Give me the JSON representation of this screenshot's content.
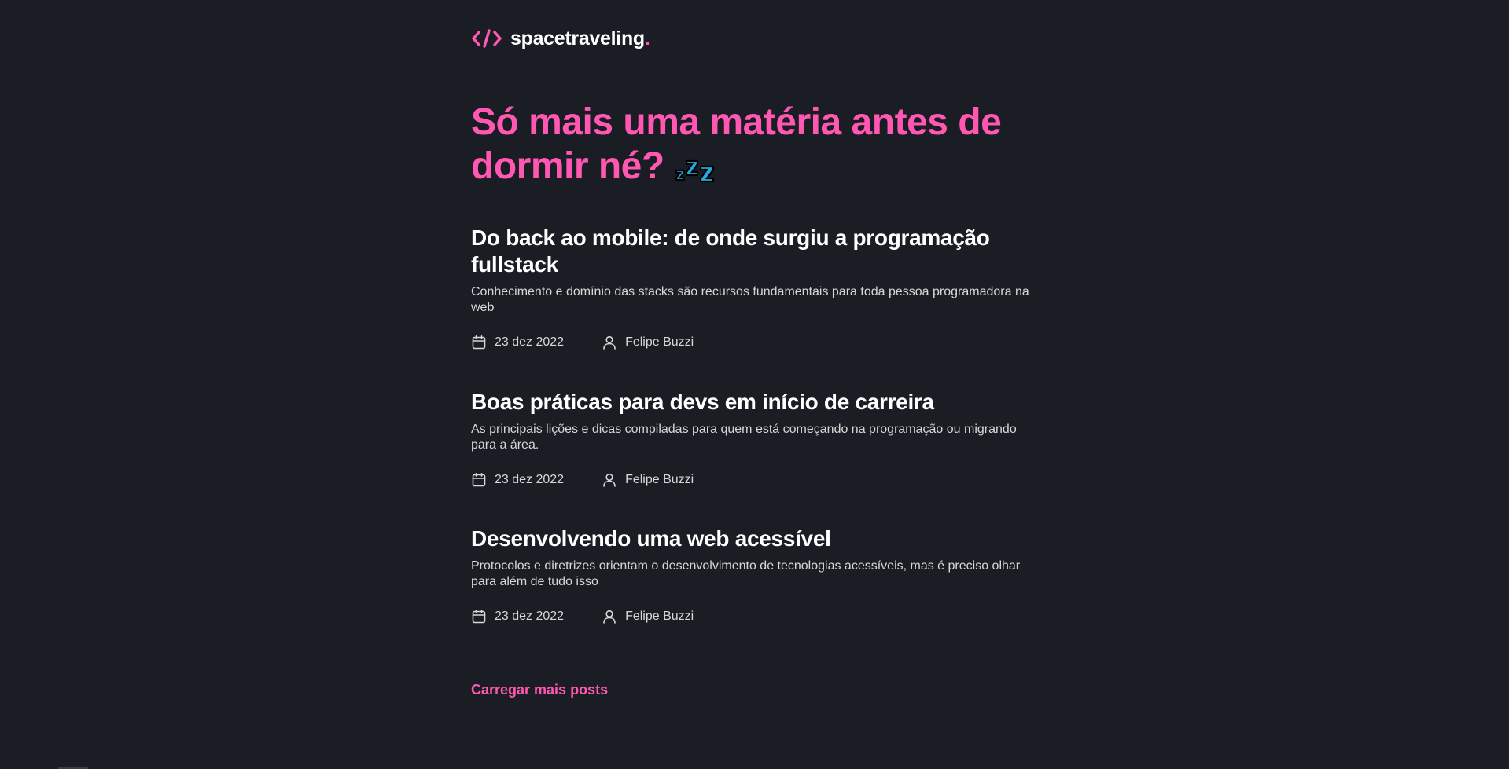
{
  "header": {
    "logo_text": "spacetraveling",
    "logo_dot": ".",
    "logo_icon": "code-brackets-icon",
    "accent_color": "#ff57b2"
  },
  "hero": {
    "title": "Só mais uma matéria antes de dormir né?",
    "emoji": "sleeping-zzz-icon"
  },
  "posts": [
    {
      "title": "Do back ao mobile: de onde surgiu a programação fullstack",
      "subtitle": "Conhecimento e domínio das stacks são recursos fundamentais para toda pessoa programadora na web",
      "date": "23 dez 2022",
      "author": "Felipe Buzzi"
    },
    {
      "title": "Boas práticas para devs em início de carreira",
      "subtitle": "As principais lições e dicas compiladas para quem está começando na programação ou migrando para a área.",
      "date": "23 dez 2022",
      "author": "Felipe Buzzi"
    },
    {
      "title": "Desenvolvendo uma web acessível",
      "subtitle": "Protocolos e diretrizes orientam o desenvolvimento de tecnologias acessíveis, mas é preciso olhar para além de tudo isso",
      "date": "23 dez 2022",
      "author": "Felipe Buzzi"
    }
  ],
  "load_more_label": "Carregar mais posts",
  "colors": {
    "background": "#1a1d23",
    "accent": "#ff57b2",
    "text": "#ffffff",
    "muted": "#d7d7d7"
  }
}
